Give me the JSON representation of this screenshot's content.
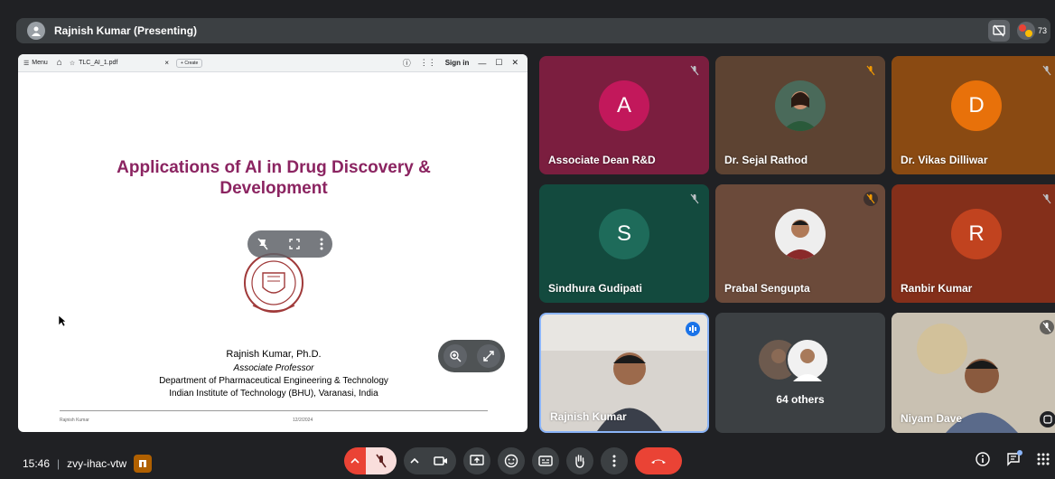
{
  "header": {
    "presenter": "Rajnish Kumar (Presenting)",
    "participant_count": "73"
  },
  "browser": {
    "menu_label": "Menu",
    "tab_title": "TLC_AI_1.pdf",
    "create_label": "Create",
    "sign_in": "Sign in"
  },
  "slide": {
    "title_line1": "Applications of AI in Drug Discovery &",
    "title_line2": "Development",
    "author": "Rajnish Kumar, Ph.D.",
    "position": "Associate Professor",
    "department": "Department of Pharmaceutical Engineering & Technology",
    "institute": "Indian Institute of Technology (BHU), Varanasi, India",
    "footer_left": "Rajnish Kumar",
    "footer_right": "12/2/2024"
  },
  "tiles": [
    {
      "name": "Associate Dean R&D",
      "avatar_letter": "A",
      "bg": "#7b1e3f",
      "avatar_bg": "#c2185b"
    },
    {
      "name": "Dr. Sejal Rathod",
      "avatar_letter": "",
      "bg": "#5d4332",
      "avatar_bg": "#8d6e63"
    },
    {
      "name": "Dr. Vikas Dilliwar",
      "avatar_letter": "D",
      "bg": "#8a4a12",
      "avatar_bg": "#e8710a"
    },
    {
      "name": "Sindhura Gudipati",
      "avatar_letter": "S",
      "bg": "#134a3e",
      "avatar_bg": "#1e6b5a"
    },
    {
      "name": "Prabal Sengupta",
      "avatar_letter": "",
      "bg": "#6b4a3a",
      "avatar_bg": "#a1887f"
    },
    {
      "name": "Ranbir Kumar",
      "avatar_letter": "R",
      "bg": "#842f1a",
      "avatar_bg": "#c1431f"
    },
    {
      "name": "Rajnish Kumar",
      "avatar_letter": "",
      "bg": "#c9c5c0",
      "avatar_bg": ""
    },
    {
      "name": "64 others",
      "avatar_letter": "",
      "bg": "#3c4043",
      "avatar_bg": ""
    },
    {
      "name": "Niyam Dave",
      "avatar_letter": "",
      "bg": "#b9b4aa",
      "avatar_bg": ""
    }
  ],
  "footer": {
    "time": "15:46",
    "meeting_code": "zvy-ihac-vtw"
  },
  "icons": {
    "mic": "mic-off-icon",
    "camera": "camera-icon",
    "present": "present-icon",
    "emoji": "emoji-icon",
    "captions": "captions-icon",
    "raise_hand": "raise-hand-icon",
    "more": "more-options-icon",
    "leave": "hang-up-icon"
  },
  "colors": {
    "title_accent": "#8b2461",
    "leave_red": "#ea4335",
    "mic_off_bg": "#f9dedc"
  }
}
